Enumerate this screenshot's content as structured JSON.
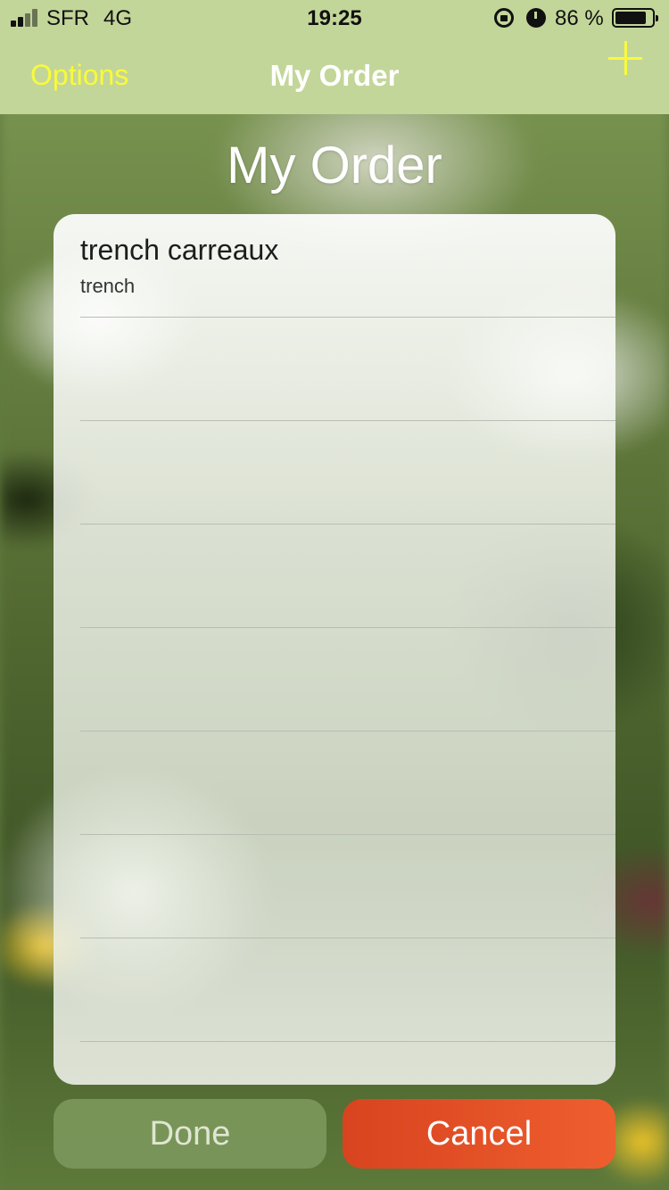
{
  "status_bar": {
    "carrier": "SFR",
    "network": "4G",
    "time": "19:25",
    "battery_percent": "86 %",
    "battery_level": 0.86,
    "icons": [
      "signal-icon",
      "rotation-lock-icon",
      "alarm-icon",
      "battery-icon"
    ]
  },
  "nav": {
    "options_label": "Options",
    "title": "My Order",
    "add_icon": "plus-icon"
  },
  "page": {
    "heading": "My Order"
  },
  "orders": [
    {
      "title": "trench carreaux",
      "subtitle": "trench"
    }
  ],
  "actions": {
    "done_label": "Done",
    "cancel_label": "Cancel"
  },
  "colors": {
    "nav_background": "#c3d699",
    "accent_yellow": "#fafa3a",
    "done_button": "#7a965a",
    "cancel_button": "#e04f26"
  }
}
